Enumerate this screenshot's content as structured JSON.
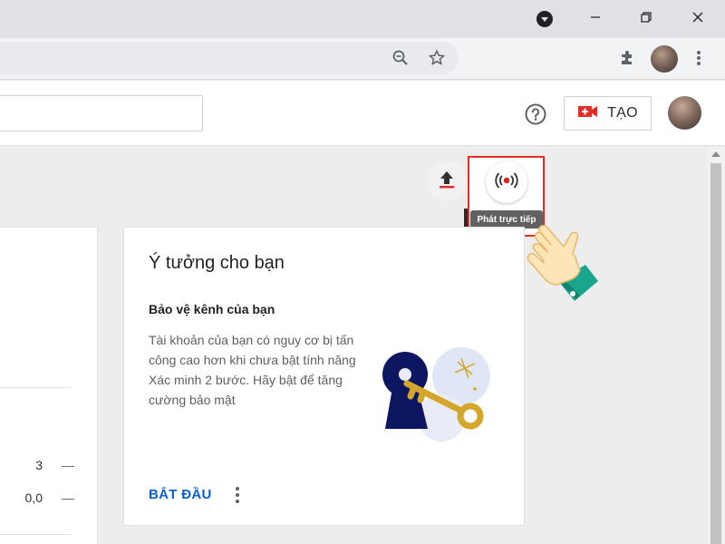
{
  "browser": {
    "icons": [
      "profile-indicator-icon",
      "minimize-icon",
      "restore-icon",
      "close-icon",
      "zoom-out-icon",
      "bookmark-star-icon",
      "extensions-icon",
      "profile-avatar",
      "kebab-menu-icon"
    ]
  },
  "header": {
    "create_label": "TẠO",
    "icons": [
      "help-icon",
      "video-camera-plus-icon"
    ]
  },
  "toolbar": {
    "upload_icon": "upload-icon",
    "live_icon": "broadcast-icon",
    "live_tooltip": "Phát trực tiếp"
  },
  "left_card": {
    "rows": [
      {
        "value": "3",
        "dash": "—"
      },
      {
        "value": "0,0",
        "dash": "—"
      }
    ]
  },
  "idea_card": {
    "title": "Ý tưởng cho bạn",
    "subtitle": "Bảo vệ kênh của bạn",
    "body": "Tài khoản của bạn có nguy cơ bị tấn công cao hơn khi chưa bật tính năng Xác minh 2 bước. Hãy bật để tăng cường bảo mật",
    "action_label": "BẮT ĐẦU",
    "illustration": "keyhole-key-illustration"
  },
  "colors": {
    "accent_red": "#e52d27",
    "link_blue": "#065fd4",
    "live_dot": "#e62117"
  }
}
